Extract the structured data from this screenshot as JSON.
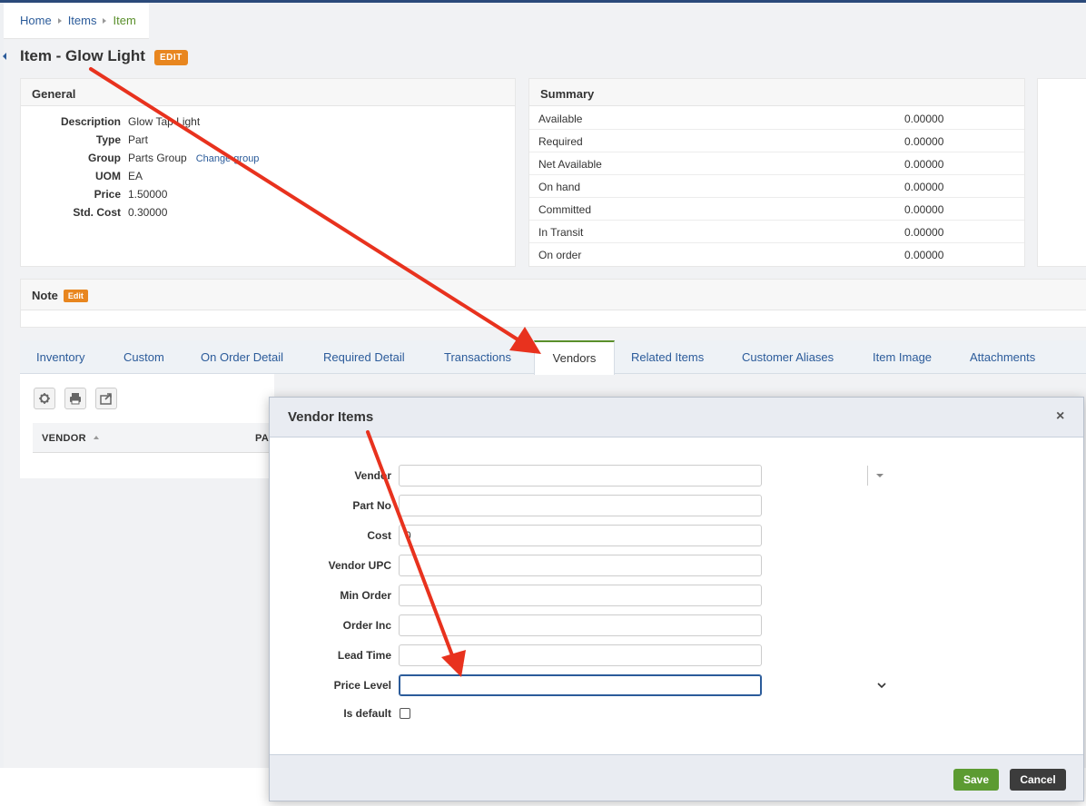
{
  "breadcrumb": {
    "items": [
      "Home",
      "Items",
      "Item"
    ]
  },
  "page": {
    "title": "Item - Glow Light",
    "edit_badge": "EDIT"
  },
  "general": {
    "heading": "General",
    "fields": [
      {
        "label": "Description",
        "value": "Glow Tap Light"
      },
      {
        "label": "Type",
        "value": "Part"
      },
      {
        "label": "Group",
        "value": "Parts Group",
        "link": "Change group"
      },
      {
        "label": "UOM",
        "value": "EA"
      },
      {
        "label": "Price",
        "value": "1.50000"
      },
      {
        "label": "Std. Cost",
        "value": "0.30000"
      }
    ]
  },
  "summary": {
    "heading": "Summary",
    "rows": [
      {
        "label": "Available",
        "value": "0.00000"
      },
      {
        "label": "Required",
        "value": "0.00000"
      },
      {
        "label": "Net Available",
        "value": "0.00000"
      },
      {
        "label": "On hand",
        "value": "0.00000"
      },
      {
        "label": "Committed",
        "value": "0.00000"
      },
      {
        "label": "In Transit",
        "value": "0.00000"
      },
      {
        "label": "On order",
        "value": "0.00000"
      }
    ]
  },
  "note": {
    "heading": "Note",
    "edit_badge": "Edit"
  },
  "tabs": [
    "Inventory",
    "Custom",
    "On Order Detail",
    "Required Detail",
    "Transactions",
    "Vendors",
    "Related Items",
    "Customer Aliases",
    "Item Image",
    "Attachments"
  ],
  "active_tab": "Vendors",
  "vendors_table": {
    "columns": [
      "VENDOR",
      "PA"
    ]
  },
  "toolbar": {
    "icons": [
      "gear-icon",
      "print-icon",
      "export-icon"
    ]
  },
  "modal": {
    "title": "Vendor Items",
    "close_glyph": "×",
    "fields": {
      "vendor": {
        "label": "Vendor",
        "value": ""
      },
      "part_no": {
        "label": "Part No",
        "value": ""
      },
      "cost": {
        "label": "Cost",
        "value": "0"
      },
      "vendor_upc": {
        "label": "Vendor UPC",
        "value": ""
      },
      "min_order": {
        "label": "Min Order",
        "value": ""
      },
      "order_inc": {
        "label": "Order Inc",
        "value": ""
      },
      "lead_time": {
        "label": "Lead Time",
        "value": ""
      },
      "price_level": {
        "label": "Price Level",
        "value": ""
      },
      "is_default": {
        "label": "Is default",
        "checked": false
      }
    },
    "save_label": "Save",
    "cancel_label": "Cancel"
  },
  "colors": {
    "accent_green": "#5c9b32",
    "link_blue": "#2b5b9a",
    "edit_orange": "#e8861f",
    "annotation_red": "#e8321e"
  }
}
